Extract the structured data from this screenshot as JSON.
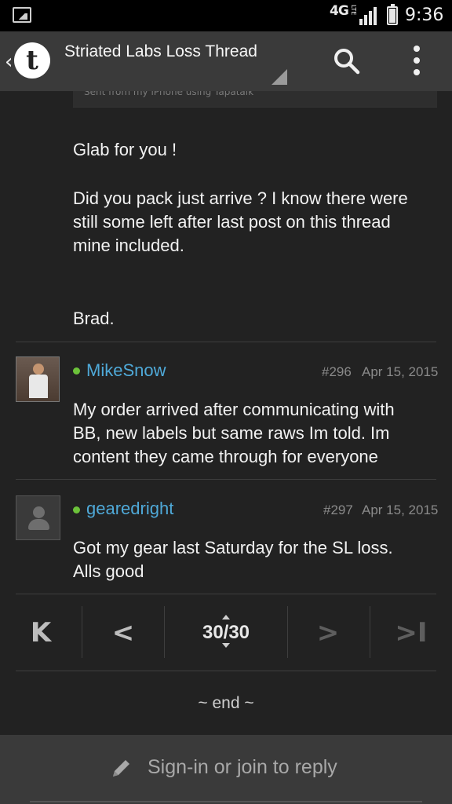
{
  "status_bar": {
    "network": "4G",
    "network_sub": "LTE",
    "time": "9:36",
    "left_icon": "image-notification-icon",
    "signal_icon": "signal-strength-icon",
    "battery_icon": "battery-icon"
  },
  "app_bar": {
    "title": "Striated Labs Loss Thread",
    "back_icon": "back-chevron-icon",
    "logo": "t",
    "search_icon": "search-icon",
    "more_icon": "overflow-menu-icon"
  },
  "posts": [
    {
      "quote_fragment": "Sent from my iPhone using Tapatalk",
      "lines": [
        "Glab for you !",
        "Did you pack just arrive ? I know there were still some left after last post on this thread mine included.",
        "Brad."
      ]
    },
    {
      "username": "MikeSnow",
      "post_number": "#296",
      "date": "Apr 15, 2015",
      "online": true,
      "body": "My order arrived after communicating with BB, new labels but same raws Im told. Im content they came through for everyone"
    },
    {
      "username": "gearedright",
      "post_number": "#297",
      "date": "Apr 15, 2015",
      "online": true,
      "body": "Got my gear last Saturday for the SL loss. Alls good"
    }
  ],
  "pagination": {
    "first_label": "K",
    "prev_label": "<",
    "current": "30/30",
    "next_label": ">",
    "last_label": ">I"
  },
  "end_label": "~ end ~",
  "reply_bar": {
    "label": "Sign-in or join to reply",
    "icon": "pencil-icon"
  },
  "colors": {
    "background": "#222222",
    "header": "#3a3a3a",
    "username": "#4fa9d8",
    "online": "#6cc23a"
  }
}
